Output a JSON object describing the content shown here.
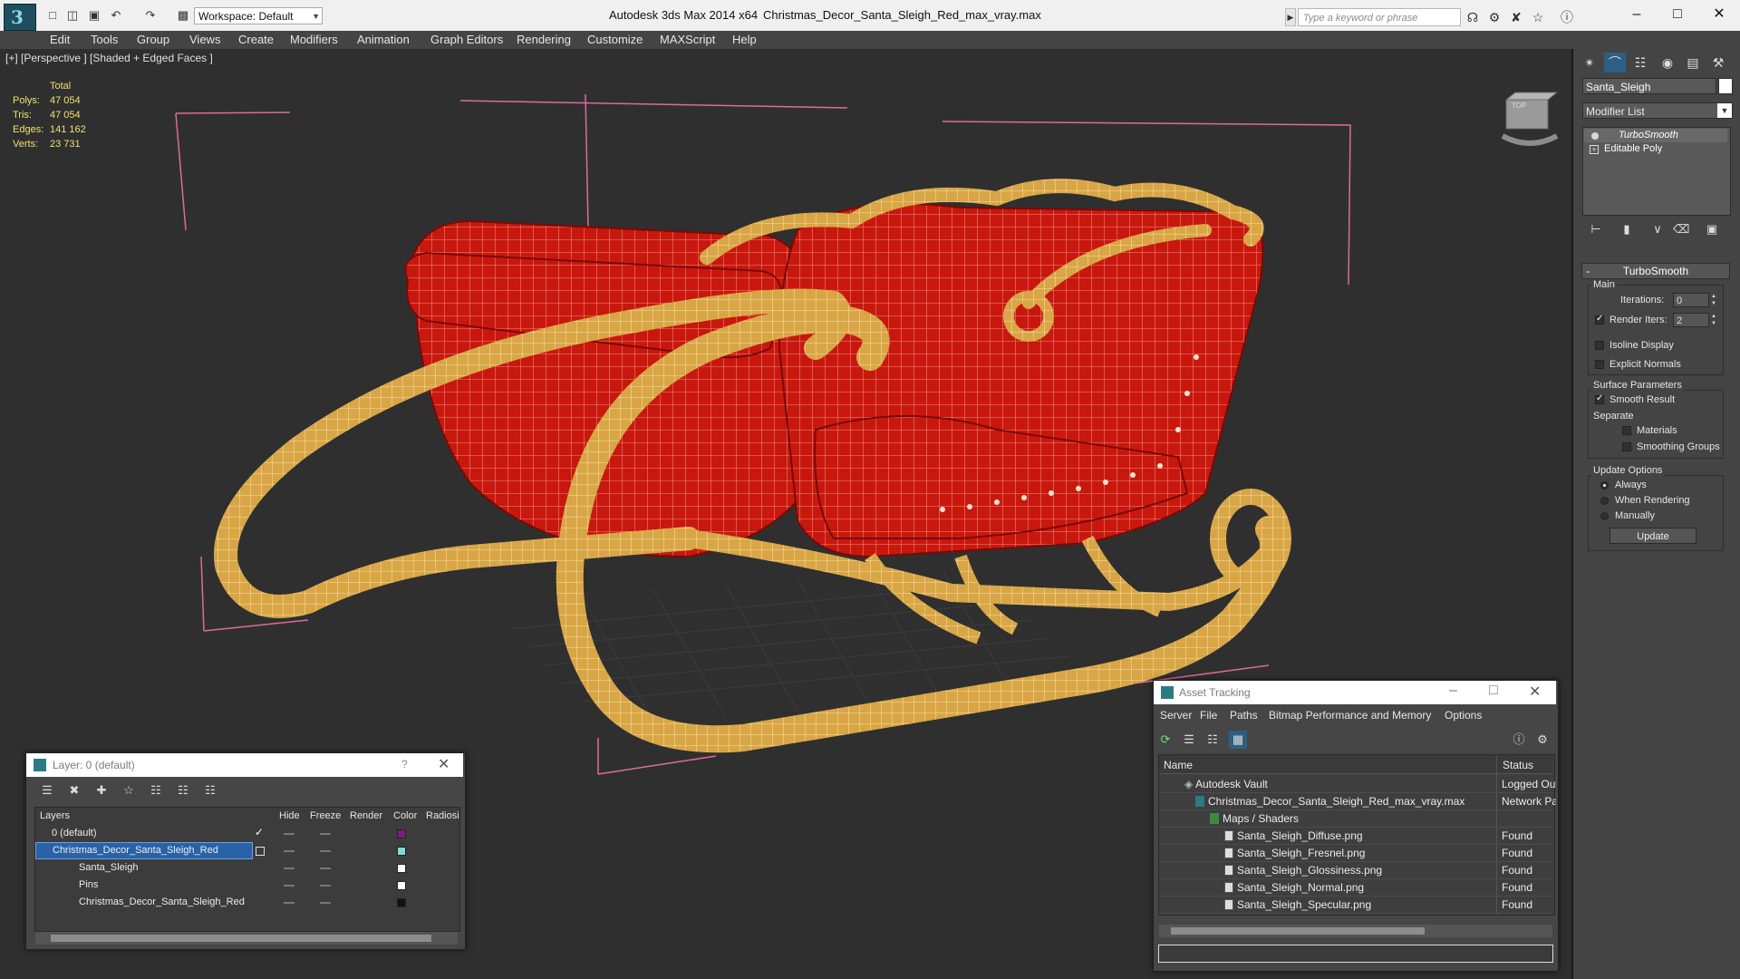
{
  "titlebar": {
    "workspace": "Workspace: Default",
    "app_title": "Autodesk 3ds Max  2014 x64",
    "file_title": "Christmas_Decor_Santa_Sleigh_Red_max_vray.max",
    "search_placeholder": "Type a keyword or phrase"
  },
  "menu": [
    "Edit",
    "Tools",
    "Group",
    "Views",
    "Create",
    "Modifiers",
    "Animation",
    "Graph Editors",
    "Rendering",
    "Customize",
    "MAXScript",
    "Help"
  ],
  "viewport": {
    "label": "[+] [Perspective ] [Shaded + Edged Faces ]",
    "stats": {
      "header": "Total",
      "rows": [
        {
          "label": "Polys:",
          "value": "47 054"
        },
        {
          "label": "Tris:",
          "value": "47 054"
        },
        {
          "label": "Edges:",
          "value": "141 162"
        },
        {
          "label": "Verts:",
          "value": "23 731"
        }
      ]
    },
    "viewcube_label": "TOP"
  },
  "command_panel": {
    "object_name": "Santa_Sleigh",
    "object_color": "#ffffff",
    "modifier_list": "Modifier List",
    "stack": [
      "TurboSmooth",
      "Editable Poly"
    ],
    "rollout": "TurboSmooth",
    "main": {
      "label": "Main",
      "iterations_label": "Iterations:",
      "iterations": "0",
      "render_iters_label": "Render Iters:",
      "render_iters": "2",
      "isoline": "Isoline Display",
      "explicit_normals": "Explicit Normals"
    },
    "surface": {
      "label": "Surface Parameters",
      "smooth_result": "Smooth Result",
      "separate": "Separate",
      "materials": "Materials",
      "smoothing_groups": "Smoothing Groups"
    },
    "update_options": {
      "label": "Update Options",
      "always": "Always",
      "when_rendering": "When Rendering",
      "manually": "Manually",
      "update_button": "Update"
    }
  },
  "layer_dialog": {
    "title": "Layer: 0 (default)",
    "help": "?",
    "columns": [
      "Layers",
      "Hide",
      "Freeze",
      "Render",
      "Color",
      "Radiosity"
    ],
    "rows": [
      {
        "name": "0 (default)",
        "color": "#7a1e7a"
      },
      {
        "name": "Christmas_Decor_Santa_Sleigh_Red",
        "color": "#7adcd0"
      },
      {
        "name": "Santa_Sleigh",
        "color": "#ffffff"
      },
      {
        "name": "Pins",
        "color": "#ffffff"
      },
      {
        "name": "Christmas_Decor_Santa_Sleigh_Red",
        "color": "#111111"
      }
    ]
  },
  "asset_tracking": {
    "title": "Asset Tracking",
    "menu": [
      "Server",
      "File",
      "Paths",
      "Bitmap Performance and Memory",
      "Options"
    ],
    "columns": [
      "Name",
      "Status"
    ],
    "rows": [
      {
        "name": "Autodesk Vault",
        "status": "Logged Out"
      },
      {
        "name": "Christmas_Decor_Santa_Sleigh_Red_max_vray.max",
        "status": "Network Path"
      },
      {
        "name": "Maps / Shaders",
        "status": ""
      },
      {
        "name": "Santa_Sleigh_Diffuse.png",
        "status": "Found"
      },
      {
        "name": "Santa_Sleigh_Fresnel.png",
        "status": "Found"
      },
      {
        "name": "Santa_Sleigh_Glossiness.png",
        "status": "Found"
      },
      {
        "name": "Santa_Sleigh_Normal.png",
        "status": "Found"
      },
      {
        "name": "Santa_Sleigh_Specular.png",
        "status": "Found"
      }
    ]
  }
}
